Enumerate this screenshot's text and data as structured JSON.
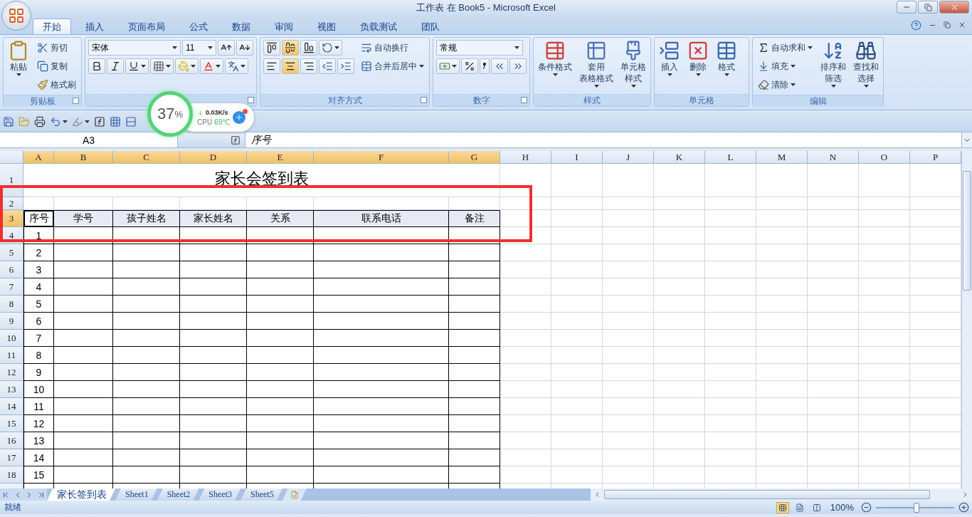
{
  "window": {
    "title": "工作表 在 Book5 - Microsoft Excel"
  },
  "ribbon_tabs": [
    {
      "label": "开始",
      "selected": true
    },
    {
      "label": "插入",
      "selected": false
    },
    {
      "label": "页面布局",
      "selected": false
    },
    {
      "label": "公式",
      "selected": false
    },
    {
      "label": "数据",
      "selected": false
    },
    {
      "label": "审阅",
      "selected": false
    },
    {
      "label": "视图",
      "selected": false
    },
    {
      "label": "负载测试",
      "selected": false
    },
    {
      "label": "团队",
      "selected": false
    }
  ],
  "ribbon_groups": [
    {
      "label": "剪贴板",
      "launcher": true,
      "columns": [
        [
          [
            {
              "kind": "large",
              "lines": [
                "粘贴"
              ],
              "menu": true
            }
          ]
        ],
        [
          [
            {
              "kind": "small",
              "label": "剪切",
              "menu": false
            }
          ],
          [
            {
              "kind": "small",
              "label": "复制",
              "menu": false
            }
          ],
          [
            {
              "kind": "small",
              "label": "格式刷",
              "menu": false
            }
          ]
        ]
      ]
    },
    {
      "launcher": true,
      "columns": [
        [
          [
            {
              "kind": "combo",
              "value": "宋体"
            },
            {
              "kind": "combo",
              "value": "11"
            },
            {
              "kind": "icon",
              "menu": false
            },
            {
              "kind": "icon",
              "menu": false
            }
          ],
          [
            {
              "kind": "toggle",
              "selected": false,
              "menu": false
            },
            {
              "kind": "toggle",
              "selected": false,
              "menu": false
            },
            {
              "kind": "toggle",
              "selected": false,
              "menu": true
            },
            {
              "kind": "icon",
              "menu": true
            },
            {
              "kind": "icon",
              "menu": true
            },
            {
              "kind": "icon",
              "menu": true
            },
            {
              "kind": "icon",
              "menu": true
            }
          ]
        ]
      ]
    },
    {
      "label": "对齐方式",
      "launcher": true,
      "columns": [
        [
          [
            {
              "kind": "toggle",
              "selected": false,
              "menu": false
            },
            {
              "kind": "toggle",
              "selected": true,
              "menu": false
            },
            {
              "kind": "toggle",
              "selected": false,
              "menu": false
            },
            {
              "kind": "icon",
              "menu": true
            }
          ],
          [
            {
              "kind": "toggle",
              "selected": false,
              "menu": false
            },
            {
              "kind": "toggle",
              "selected": true,
              "menu": false
            },
            {
              "kind": "toggle",
              "selected": false,
              "menu": false
            },
            {
              "kind": "icon",
              "menu": false
            },
            {
              "kind": "icon",
              "menu": false
            }
          ]
        ],
        [
          [
            {
              "kind": "small",
              "label": "自动换行",
              "menu": false
            }
          ],
          [
            {
              "kind": "small",
              "label": "合并后居中",
              "menu": true
            }
          ]
        ]
      ]
    },
    {
      "label": "数字",
      "launcher": true,
      "columns": [
        [
          [
            {
              "kind": "combo",
              "value": "常规"
            }
          ],
          [
            {
              "kind": "icon",
              "menu": true
            },
            {
              "kind": "icon",
              "menu": false
            },
            {
              "kind": "icon",
              "menu": false
            },
            {
              "kind": "icon",
              "menu": false
            },
            {
              "kind": "icon",
              "menu": false
            }
          ]
        ]
      ]
    },
    {
      "label": "样式",
      "launcher": false,
      "columns": [
        [
          [
            {
              "kind": "large",
              "lines": [
                "条件格式"
              ],
              "menu": true
            }
          ]
        ],
        [
          [
            {
              "kind": "large",
              "lines": [
                "套用",
                "表格格式"
              ],
              "menu": true
            }
          ]
        ],
        [
          [
            {
              "kind": "large",
              "lines": [
                "单元格",
                "样式"
              ],
              "menu": true
            }
          ]
        ]
      ]
    },
    {
      "label": "单元格",
      "launcher": false,
      "columns": [
        [
          [
            {
              "kind": "large",
              "lines": [
                "插入"
              ],
              "menu": true
            }
          ]
        ],
        [
          [
            {
              "kind": "large",
              "lines": [
                "删除"
              ],
              "menu": true
            }
          ]
        ],
        [
          [
            {
              "kind": "large",
              "lines": [
                "格式"
              ],
              "menu": true
            }
          ]
        ]
      ]
    },
    {
      "label": "编辑",
      "launcher": false,
      "columns": [
        [
          [
            {
              "kind": "small",
              "label": "自动求和",
              "menu": true
            }
          ],
          [
            {
              "kind": "small",
              "label": "填充",
              "menu": true
            }
          ],
          [
            {
              "kind": "small",
              "label": "清除",
              "menu": true
            }
          ]
        ],
        [
          [
            {
              "kind": "large",
              "lines": [
                "排序和",
                "筛选"
              ],
              "menu": true
            }
          ]
        ],
        [
          [
            {
              "kind": "large",
              "lines": [
                "查找和",
                "选择"
              ],
              "menu": true
            }
          ]
        ]
      ]
    }
  ],
  "name_box": "A3",
  "formula": "序号",
  "sheet": {
    "columns": [
      {
        "label": "A",
        "selected": true
      },
      {
        "label": "B",
        "selected": true
      },
      {
        "label": "C",
        "selected": true
      },
      {
        "label": "D",
        "selected": true
      },
      {
        "label": "E",
        "selected": true
      },
      {
        "label": "F",
        "selected": true
      },
      {
        "label": "G",
        "selected": true
      },
      {
        "label": "H",
        "selected": false
      },
      {
        "label": "I",
        "selected": false
      },
      {
        "label": "J",
        "selected": false
      },
      {
        "label": "K",
        "selected": false
      },
      {
        "label": "L",
        "selected": false
      },
      {
        "label": "M",
        "selected": false
      },
      {
        "label": "N",
        "selected": false
      },
      {
        "label": "O",
        "selected": false
      },
      {
        "label": "P",
        "selected": false
      }
    ],
    "rows": [
      {
        "label": "1",
        "selected": false
      },
      {
        "label": "2",
        "selected": false
      },
      {
        "label": "3",
        "selected": true
      },
      {
        "label": "4",
        "selected": false
      },
      {
        "label": "5",
        "selected": false
      },
      {
        "label": "6",
        "selected": false
      },
      {
        "label": "7",
        "selected": false
      },
      {
        "label": "8",
        "selected": false
      },
      {
        "label": "9",
        "selected": false
      },
      {
        "label": "10",
        "selected": false
      },
      {
        "label": "11",
        "selected": false
      },
      {
        "label": "12",
        "selected": false
      },
      {
        "label": "13",
        "selected": false
      },
      {
        "label": "14",
        "selected": false
      },
      {
        "label": "15",
        "selected": false
      },
      {
        "label": "16",
        "selected": false
      },
      {
        "label": "17",
        "selected": false
      },
      {
        "label": "18",
        "selected": false
      }
    ],
    "title": "家长会签到表",
    "table_header": [
      {
        "text": "序号",
        "selected": false,
        "active": true
      },
      {
        "text": "学号",
        "selected": true,
        "active": false
      },
      {
        "text": "孩子姓名",
        "selected": true,
        "active": false
      },
      {
        "text": "家长姓名",
        "selected": true,
        "active": false
      },
      {
        "text": "关系",
        "selected": true,
        "active": false
      },
      {
        "text": "联系电话",
        "selected": true,
        "active": false
      },
      {
        "text": "备注",
        "selected": true,
        "active": false
      }
    ],
    "numbers": [
      "1",
      "2",
      "3",
      "4",
      "5",
      "6",
      "7",
      "8",
      "9",
      "10",
      "11",
      "12",
      "13",
      "14",
      "15"
    ]
  },
  "sheet_tabs": [
    {
      "label": "家长签到表",
      "selected": true
    },
    {
      "label": "Sheet1",
      "selected": false
    },
    {
      "label": "Sheet2",
      "selected": false
    },
    {
      "label": "Sheet3",
      "selected": false
    },
    {
      "label": "Sheet5",
      "selected": false
    }
  ],
  "status": {
    "text": "就绪",
    "view_buttons": [
      {
        "selected": true
      },
      {
        "selected": false
      },
      {
        "selected": false
      }
    ],
    "zoom": {
      "label": "100%",
      "level": 0.52
    }
  },
  "monitor": {
    "percent": "37",
    "unit": "%",
    "speed": "0.03K/s",
    "cpu_label": "CPU",
    "temp": "69℃"
  }
}
